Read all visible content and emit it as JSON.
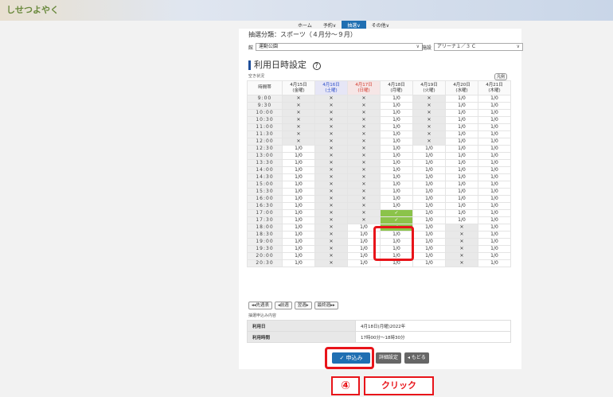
{
  "app": {
    "logo": "しせつよやく"
  },
  "nav": [
    {
      "label": "ホーム"
    },
    {
      "label": "予約∨"
    },
    {
      "label": "抽選∨"
    },
    {
      "label": "その他∨"
    }
  ],
  "page": {
    "cut_title": "抽選分類：スポーツ（４月分〜９月）",
    "place_label": "館",
    "place_value": "運動公園",
    "facility_label": "施設",
    "facility_value": "アリーナ１／３ C",
    "section_title": "利用日時設定",
    "help_icon": "?",
    "vacancy_label": "空き状況",
    "legend_label": "凡例"
  },
  "grid": {
    "header_time": "時間帯",
    "days": [
      {
        "date": "4月15日",
        "dow": "(金曜)",
        "type": "normal"
      },
      {
        "date": "4月16日",
        "dow": "(土曜)",
        "type": "sat"
      },
      {
        "date": "4月17日",
        "dow": "(日曜)",
        "type": "sun"
      },
      {
        "date": "4月18日",
        "dow": "(月曜)",
        "type": "normal"
      },
      {
        "date": "4月19日",
        "dow": "(火曜)",
        "type": "normal"
      },
      {
        "date": "4月20日",
        "dow": "(水曜)",
        "type": "normal"
      },
      {
        "date": "4月21日",
        "dow": "(木曜)",
        "type": "normal"
      }
    ],
    "rows": [
      {
        "time": "9:00",
        "cells": [
          "x",
          "x",
          "x",
          "1/0",
          "x",
          "1/0",
          "1/0"
        ]
      },
      {
        "time": "9:30",
        "cells": [
          "x",
          "x",
          "x",
          "1/0",
          "x",
          "1/0",
          "1/0"
        ]
      },
      {
        "time": "10:00",
        "cells": [
          "x",
          "x",
          "x",
          "1/0",
          "x",
          "1/0",
          "1/0"
        ]
      },
      {
        "time": "10:30",
        "cells": [
          "x",
          "x",
          "x",
          "1/0",
          "x",
          "1/0",
          "1/0"
        ]
      },
      {
        "time": "11:00",
        "cells": [
          "x",
          "x",
          "x",
          "1/0",
          "x",
          "1/0",
          "1/0"
        ]
      },
      {
        "time": "11:30",
        "cells": [
          "x",
          "x",
          "x",
          "1/0",
          "x",
          "1/0",
          "1/0"
        ]
      },
      {
        "time": "12:00",
        "cells": [
          "x",
          "x",
          "x",
          "1/0",
          "x",
          "1/0",
          "1/0"
        ]
      },
      {
        "time": "12:30",
        "cells": [
          "1/0",
          "x",
          "x",
          "1/0",
          "1/0",
          "1/0",
          "1/0"
        ]
      },
      {
        "time": "13:00",
        "cells": [
          "1/0",
          "x",
          "x",
          "1/0",
          "1/0",
          "1/0",
          "1/0"
        ]
      },
      {
        "time": "13:30",
        "cells": [
          "1/0",
          "x",
          "x",
          "1/0",
          "1/0",
          "1/0",
          "1/0"
        ]
      },
      {
        "time": "14:00",
        "cells": [
          "1/0",
          "x",
          "x",
          "1/0",
          "1/0",
          "1/0",
          "1/0"
        ]
      },
      {
        "time": "14:30",
        "cells": [
          "1/0",
          "x",
          "x",
          "1/0",
          "1/0",
          "1/0",
          "1/0"
        ]
      },
      {
        "time": "15:00",
        "cells": [
          "1/0",
          "x",
          "x",
          "1/0",
          "1/0",
          "1/0",
          "1/0"
        ]
      },
      {
        "time": "15:30",
        "cells": [
          "1/0",
          "x",
          "x",
          "1/0",
          "1/0",
          "1/0",
          "1/0"
        ]
      },
      {
        "time": "16:00",
        "cells": [
          "1/0",
          "x",
          "x",
          "1/0",
          "1/0",
          "1/0",
          "1/0"
        ]
      },
      {
        "time": "16:30",
        "cells": [
          "1/0",
          "x",
          "x",
          "1/0",
          "1/0",
          "1/0",
          "1/0"
        ]
      },
      {
        "time": "17:00",
        "cells": [
          "1/0",
          "x",
          "x",
          "sel",
          "1/0",
          "1/0",
          "1/0"
        ]
      },
      {
        "time": "17:30",
        "cells": [
          "1/0",
          "x",
          "x",
          "sel",
          "1/0",
          "1/0",
          "1/0"
        ]
      },
      {
        "time": "18:00",
        "cells": [
          "1/0",
          "x",
          "1/0",
          "sel",
          "1/0",
          "x",
          "1/0"
        ]
      },
      {
        "time": "18:30",
        "cells": [
          "1/0",
          "x",
          "1/0",
          "1/0",
          "1/0",
          "x",
          "1/0"
        ]
      },
      {
        "time": "19:00",
        "cells": [
          "1/0",
          "x",
          "1/0",
          "1/0",
          "1/0",
          "x",
          "1/0"
        ]
      },
      {
        "time": "19:30",
        "cells": [
          "1/0",
          "x",
          "1/0",
          "1/0",
          "1/0",
          "x",
          "1/0"
        ]
      },
      {
        "time": "20:00",
        "cells": [
          "1/0",
          "x",
          "1/0",
          "1/0",
          "1/0",
          "x",
          "1/0"
        ]
      },
      {
        "time": "20:30",
        "cells": [
          "1/0",
          "x",
          "1/0",
          "1/0",
          "1/0",
          "x",
          "1/0"
        ]
      }
    ],
    "x_glyph": "✕",
    "check_glyph": "✓"
  },
  "paging": [
    {
      "label": "◂◂先週表"
    },
    {
      "label": "◂前週"
    },
    {
      "label": "翌週▸"
    },
    {
      "label": "最終週▸▸"
    }
  ],
  "detail": {
    "label": "抽選申込み内容",
    "rows": [
      {
        "key": "利用日",
        "value": "4月18日(月曜)2022年"
      },
      {
        "key": "利用時間",
        "value": "17時00分〜18時30分"
      }
    ]
  },
  "actions": {
    "apply": "✓ 申込み",
    "clear": "詳細設定",
    "back": "◂ もどる"
  },
  "callout": {
    "step": "④",
    "text": "クリック"
  },
  "colors": {
    "accent": "#1f6fb2",
    "selected": "#8bc34a",
    "highlight": "#e8141a"
  }
}
